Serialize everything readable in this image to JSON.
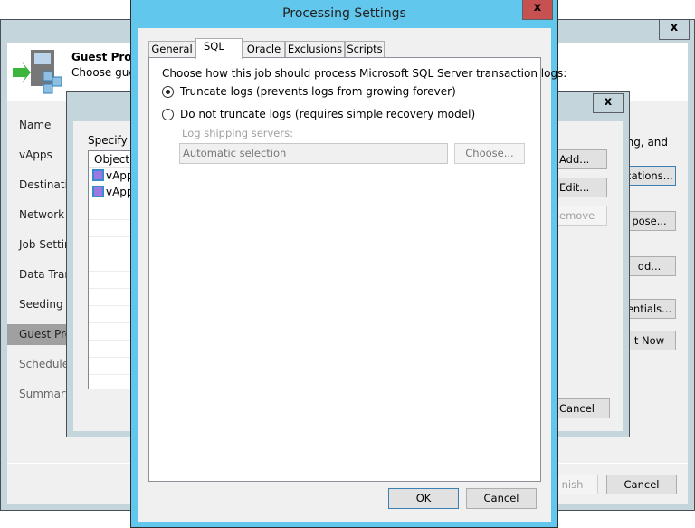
{
  "back_window": {
    "header_title": "Guest Proce",
    "header_subtitle": "Choose gues",
    "nav": [
      "Name",
      "vApps",
      "Destination",
      "Network",
      "Job Settin",
      "Data Tran",
      "Seeding",
      "Guest Pro",
      "Schedule",
      "Summary"
    ],
    "selected_nav": 7,
    "description_fragment": "sing, and",
    "buttons": [
      "cations...",
      "pose...",
      "dd...",
      "entials...",
      "t Now"
    ],
    "finish": "nish",
    "cancel": "Cancel",
    "close": "x"
  },
  "middle_window": {
    "close": "x",
    "label": "Specify a",
    "column": "Object",
    "items": [
      "vApp",
      "vApp"
    ],
    "add": "Add...",
    "edit": "Edit...",
    "remove": "emove",
    "cancel": "Cancel"
  },
  "dialog": {
    "title": "Processing Settings",
    "close": "x",
    "tabs": [
      "General",
      "SQL",
      "Oracle",
      "Exclusions",
      "Scripts"
    ],
    "active_tab": 1,
    "prompt": "Choose how this job should process Microsoft SQL Server transaction logs:",
    "option_truncate": "Truncate logs (prevents logs from growing forever)",
    "option_no_truncate": "Do not truncate logs (requires simple recovery model)",
    "selected_option": "truncate",
    "log_shipping_label": "Log shipping servers:",
    "log_shipping_value": "Automatic selection",
    "choose": "Choose...",
    "ok": "OK",
    "cancel": "Cancel"
  }
}
